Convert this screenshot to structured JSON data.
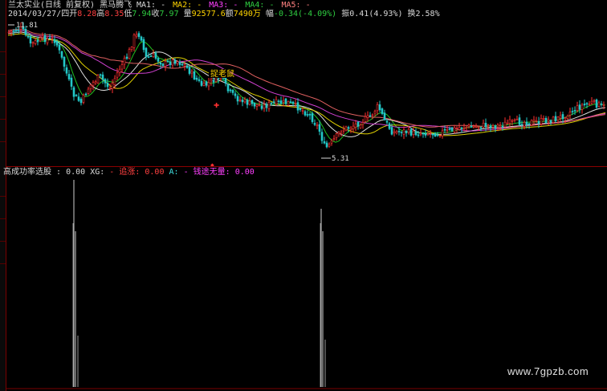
{
  "header": {
    "stock_name": "兰太实业",
    "chart_mode": "(日线 前复权)",
    "indicator_name": "黑马腾飞",
    "ma_labels": [
      {
        "label": "MA1:",
        "value": "-",
        "color": "#d8d8d8"
      },
      {
        "label": "MA2:",
        "value": "-",
        "color": "#ffd400"
      },
      {
        "label": "MA3:",
        "value": "-",
        "color": "#ff40ff"
      },
      {
        "label": "MA4:",
        "value": "-",
        "color": "#2ecc40"
      },
      {
        "label": "MA5:",
        "value": "-",
        "color": "#ff8080"
      }
    ]
  },
  "quote": {
    "date": "2014/03/27/四",
    "open_label": "开",
    "open": "8.28",
    "high_label": "高",
    "high": "8.35",
    "low_label": "低",
    "low": "7.94",
    "close_label": "收",
    "close": "7.97",
    "volume_label": "量",
    "volume": "92577.6",
    "amount_label": "额",
    "amount": "7490万",
    "change_label": "幅",
    "change": "-0.34(-4.09%)",
    "amplitude_label": "振",
    "amplitude": "0.41(4.93%)",
    "turnover_label": "换",
    "turnover": "2.58%"
  },
  "price_chart": {
    "high_marker": "11.81",
    "low_marker": "5.31",
    "annotation_label": "捉老鼠",
    "colors": {
      "up": "#ff3030",
      "down": "#22c8c8",
      "ma_white": "#e0e0e0",
      "ma_yellow": "#e0d000",
      "ma_magenta": "#d040d0",
      "ma_green": "#20c020",
      "ma_pink": "#e06060"
    }
  },
  "sub_panel": {
    "title": "高成功率选股",
    "title_value": "0.00",
    "xg_label": "XG:",
    "zhuizhang_label": "追涨",
    "zhuizhang_value": "0.00",
    "a_label": "A:",
    "qiantuwuliang_label": "钱途无量",
    "qiantuwuliang_value": "0.00"
  },
  "watermark": "www.7gpzb.com"
}
